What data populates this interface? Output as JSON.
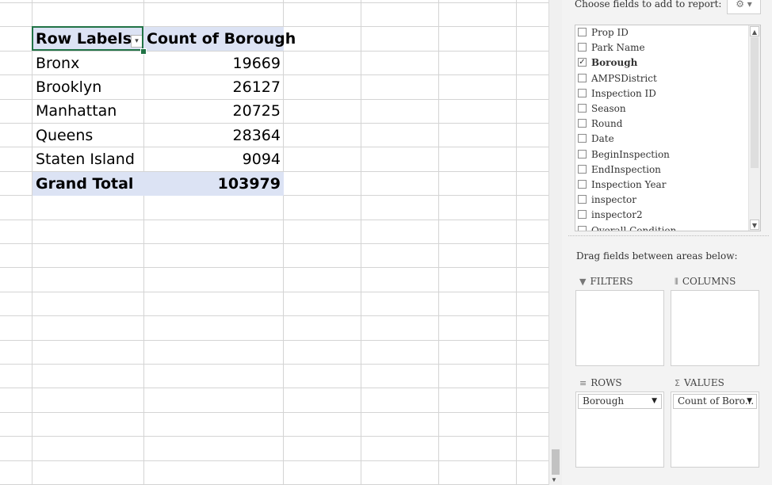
{
  "pivot": {
    "header": {
      "row_labels": "Row Labels",
      "count_label": "Count of Borough"
    },
    "rows": [
      {
        "label": "Bronx",
        "value": "19669"
      },
      {
        "label": "Brooklyn",
        "value": "26127"
      },
      {
        "label": "Manhattan",
        "value": "20725"
      },
      {
        "label": "Queens",
        "value": "28364"
      },
      {
        "label": "Staten Island",
        "value": "9094"
      }
    ],
    "total": {
      "label": "Grand Total",
      "value": "103979"
    },
    "header_fill": "#dce3f4",
    "selection_color": "#217346"
  },
  "pane": {
    "choose_fields_label": "Choose fields to add to report:",
    "gear_icon": "gear-icon",
    "fields": [
      {
        "name": "Prop ID",
        "checked": false
      },
      {
        "name": "Park Name",
        "checked": false
      },
      {
        "name": "Borough",
        "checked": true
      },
      {
        "name": "AMPSDistrict",
        "checked": false
      },
      {
        "name": "Inspection ID",
        "checked": false
      },
      {
        "name": "Season",
        "checked": false
      },
      {
        "name": "Round",
        "checked": false
      },
      {
        "name": "Date",
        "checked": false
      },
      {
        "name": "BeginInspection",
        "checked": false
      },
      {
        "name": "EndInspection",
        "checked": false
      },
      {
        "name": "Inspection Year",
        "checked": false
      },
      {
        "name": "inspector",
        "checked": false
      },
      {
        "name": "inspector2",
        "checked": false
      },
      {
        "name": "Overall Condition",
        "checked": false
      }
    ],
    "drag_label": "Drag fields between areas below:",
    "areas": {
      "filters": {
        "title": "FILTERS"
      },
      "columns": {
        "title": "COLUMNS"
      },
      "rows": {
        "title": "ROWS",
        "item": "Borough"
      },
      "values": {
        "title": "VALUES",
        "item": "Count of Boro..."
      }
    }
  }
}
